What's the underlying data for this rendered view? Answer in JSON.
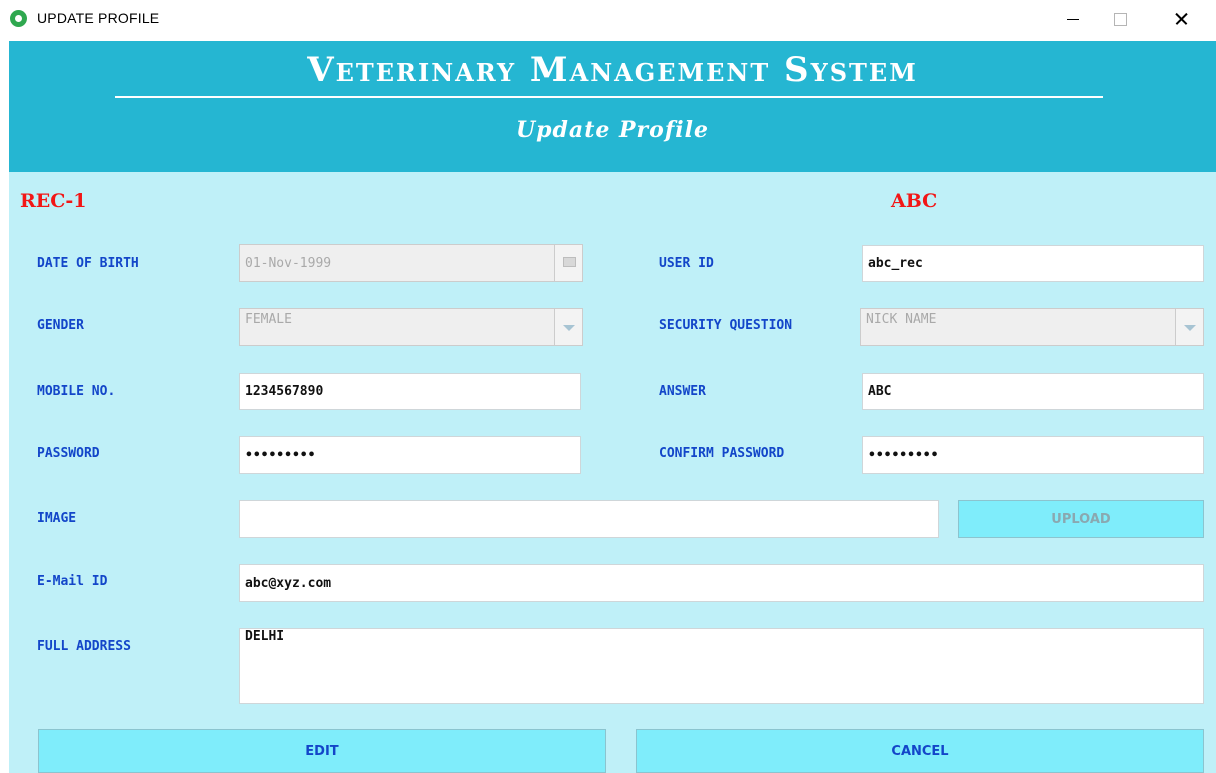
{
  "window": {
    "title": "UPDATE PROFILE"
  },
  "header": {
    "title": "Veterinary Management System",
    "subtitle": "Update Profile"
  },
  "record": {
    "id": "REC-1",
    "name": "ABC"
  },
  "form": {
    "dob": {
      "label": "DATE OF BIRTH",
      "value": "01-Nov-1999"
    },
    "gender": {
      "label": "GENDER",
      "value": "FEMALE"
    },
    "mobile": {
      "label": "MOBILE NO.",
      "value": "1234567890"
    },
    "password": {
      "label": "PASSWORD",
      "value": "•••••••••"
    },
    "image": {
      "label": "IMAGE",
      "value": ""
    },
    "email": {
      "label": "E-Mail ID",
      "value": "abc@xyz.com"
    },
    "address": {
      "label": "FULL ADDRESS",
      "value": "DELHI"
    },
    "user_id": {
      "label": "USER ID",
      "value": "abc_rec"
    },
    "security_question": {
      "label": "SECURITY QUESTION",
      "value": "NICK NAME"
    },
    "answer": {
      "label": "ANSWER",
      "value": "ABC"
    },
    "confirm_password": {
      "label": "CONFIRM PASSWORD",
      "value": "•••••••••"
    }
  },
  "buttons": {
    "upload": "UPLOAD",
    "edit": "EDIT",
    "cancel": "CANCEL"
  },
  "icons": {
    "app": "app-logo-icon",
    "dob_picker": "calendar-icon",
    "dropdown": "chevron-down-icon"
  },
  "colors": {
    "header_bg": "#25b6d2",
    "panel_bg": "#bff0f8",
    "label": "#1346c9",
    "highlight": "#f21616",
    "button_bg": "#7fedfb"
  }
}
